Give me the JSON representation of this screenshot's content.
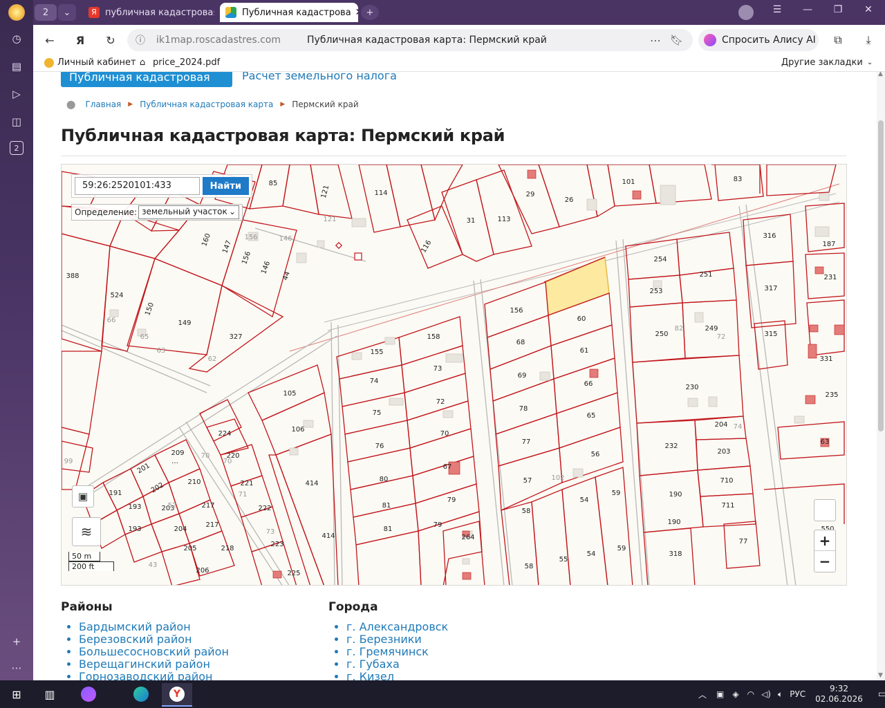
{
  "browser": {
    "tab_count": "2",
    "tabs": [
      {
        "label": "публичная кадастровая к",
        "active": false
      },
      {
        "label": "Публичная кадастрова",
        "active": true
      }
    ],
    "url_host": "ik1map.roscadastres.com",
    "page_title": "Публичная кадастровая карта: Пермский край",
    "alice_label": "Спросить Алису AI",
    "bookmarks": [
      "Личный кабинет",
      "price_2024.pdf"
    ],
    "other_bookmarks": "Другие закладки",
    "side_badge": "2"
  },
  "page": {
    "nav_active": "Публичная кадастровая карта",
    "nav_link": "Расчет земельного налога",
    "breadcrumbs": [
      "Главная",
      "Публичная кадастровая карта",
      "Пермский край"
    ],
    "heading": "Публичная кадастровая карта: Пермский край",
    "map": {
      "search_value": "59:26:2520101:433",
      "search_button": "Найти",
      "definition_label": "Определение:",
      "definition_value": "земельный участок",
      "scale_m": "50 m",
      "scale_ft": "200 ft",
      "zoom_in": "+",
      "zoom_out": "−"
    },
    "districts_title": "Районы",
    "districts": [
      "Бардымский район",
      "Березовский район",
      "Большесосновский район",
      "Верещагинский район",
      "Горнозаводский район"
    ],
    "cities_title": "Города",
    "cities": [
      "г. Александровск",
      "г. Березники",
      "г. Гремячинск",
      "г. Губаха",
      "г. Кизел"
    ]
  },
  "taskbar": {
    "lang": "РУС",
    "time": "9:32",
    "date": "02.06.2026",
    "notif_count": "1"
  },
  "colors": {
    "parcel_line": "#c2151b",
    "selected_parcel": "#fde9a0",
    "accent": "#1f8fd3",
    "link": "#1f7ab8"
  }
}
